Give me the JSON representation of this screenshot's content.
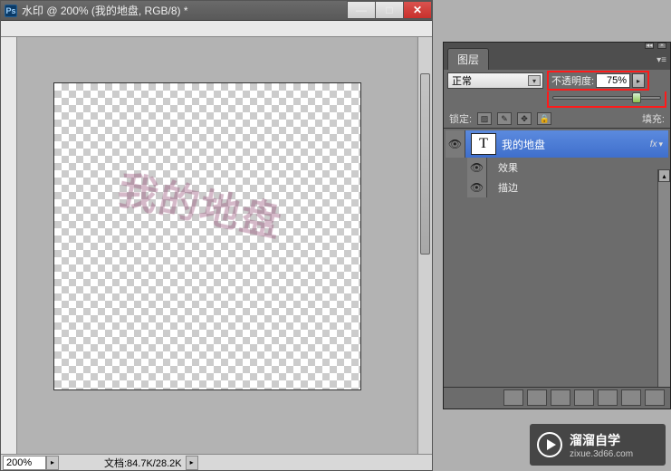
{
  "doc": {
    "ps_abbr": "Ps",
    "title": "水印 @ 200% (我的地盘, RGB/8) *",
    "watermark_text": "我的地盘"
  },
  "win_controls": {
    "minimize": "—",
    "maximize": "□",
    "close": "✕"
  },
  "status": {
    "zoom": "200%",
    "doc_info": "文档:84.7K/28.2K"
  },
  "layers_panel": {
    "tab_label": "图层",
    "blend_modes": [
      "正常"
    ],
    "blend_selected": "正常",
    "opacity_label": "不透明度:",
    "opacity_value": "75%",
    "lock_label": "锁定:",
    "fill_label": "填充:",
    "layers": [
      {
        "name": "我的地盘",
        "type": "T",
        "selected": true,
        "effects": [
          "效果",
          "描边"
        ]
      }
    ]
  },
  "brand": {
    "line1": "溜溜自学",
    "line2": "zixue.3d66.com"
  },
  "chart_data": null
}
